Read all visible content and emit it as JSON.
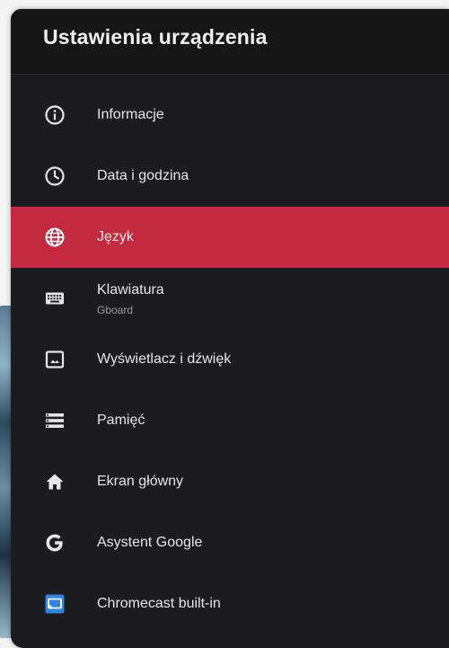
{
  "header": {
    "title": "Ustawienia urządzenia"
  },
  "menu": {
    "items": [
      {
        "label": "Informacje",
        "icon": "info-icon",
        "selected": false
      },
      {
        "label": "Data i godzina",
        "icon": "clock-icon",
        "selected": false
      },
      {
        "label": "Język",
        "icon": "globe-icon",
        "selected": true
      },
      {
        "label": "Klawiatura",
        "sublabel": "Gboard",
        "icon": "keyboard-icon",
        "selected": false
      },
      {
        "label": "Wyświetlacz i dźwięk",
        "icon": "display-icon",
        "selected": false
      },
      {
        "label": "Pamięć",
        "icon": "storage-icon",
        "selected": false
      },
      {
        "label": "Ekran główny",
        "icon": "home-icon",
        "selected": false
      },
      {
        "label": "Asystent Google",
        "icon": "google-icon",
        "selected": false
      },
      {
        "label": "Chromecast built-in",
        "icon": "cast-icon",
        "selected": false
      }
    ]
  },
  "colors": {
    "panel_background": "#1c1c1e",
    "selected_background": "#c3293f",
    "text": "#e6e6e6",
    "subtext": "#9a9a9a",
    "cast_icon": "#2f84e0"
  }
}
